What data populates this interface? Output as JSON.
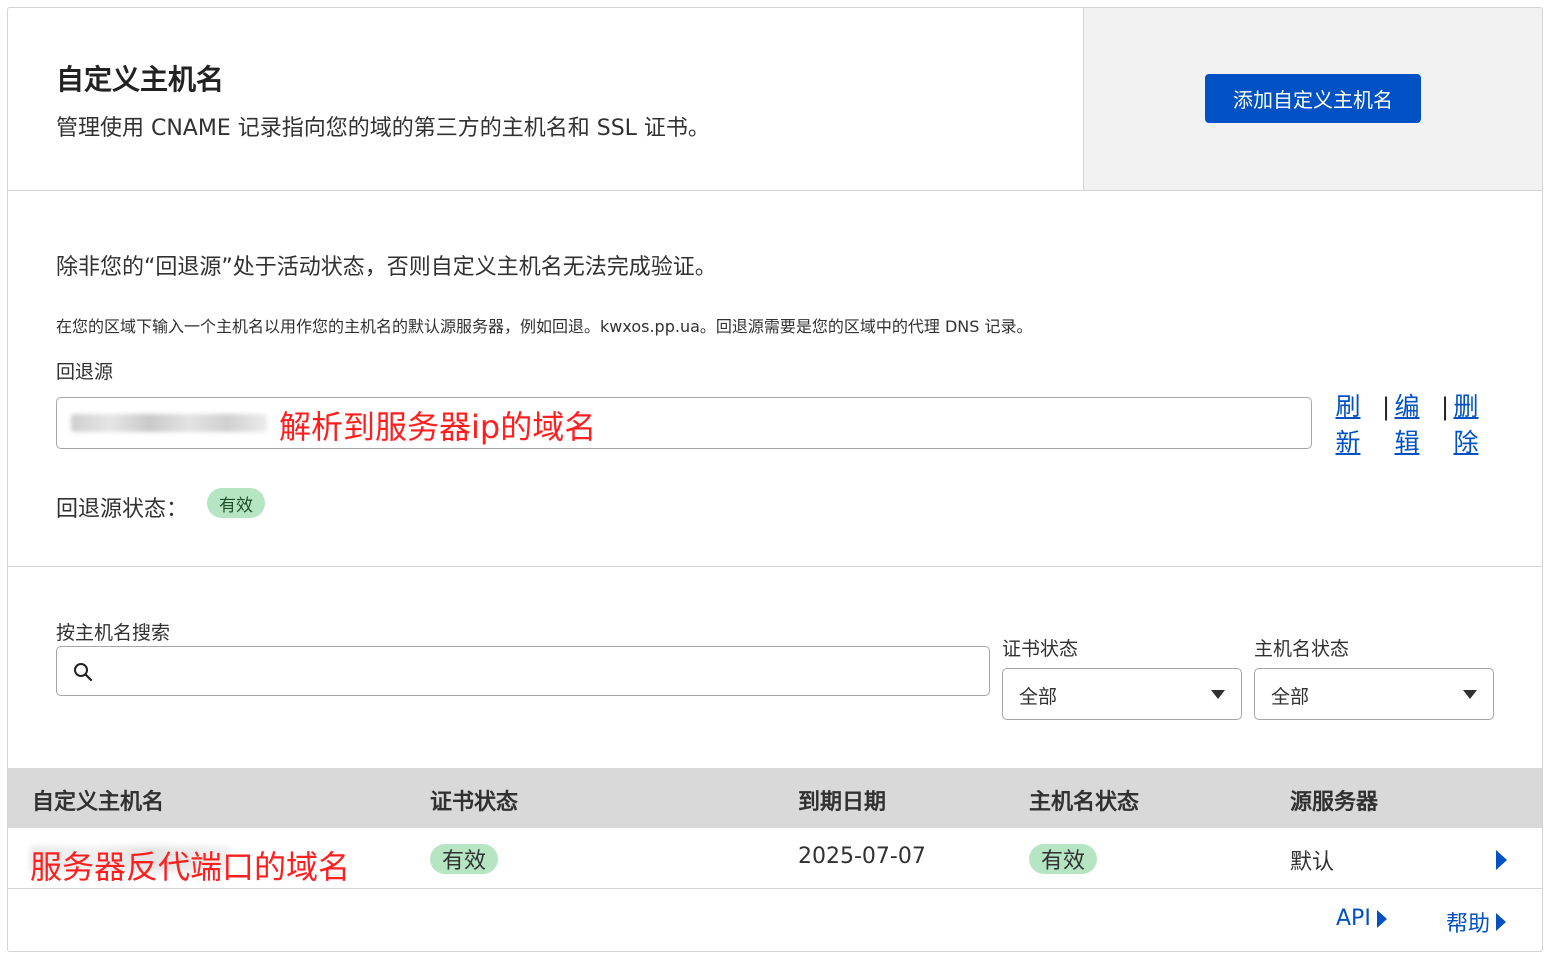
{
  "header": {
    "title": "自定义主机名",
    "subtitle": "管理使用 CNAME 记录指向您的域的第三方的主机名和 SSL 证书。",
    "add_button": "添加自定义主机名"
  },
  "fallback": {
    "notice": "除非您的“回退源”处于活动状态，否则自定义主机名无法完成验证。",
    "description": "在您的区域下输入一个主机名以用作您的主机名的默认源服务器，例如回退。kwxos.pp.ua。回退源需要是您的区域中的代理 DNS 记录。",
    "label": "回退源",
    "annotation": "解析到服务器ip的域名",
    "actions": {
      "refresh": [
        "刷",
        "新"
      ],
      "edit": [
        "编",
        "辑"
      ],
      "delete": [
        "删",
        "除"
      ],
      "separator": "|"
    },
    "status_label": "回退源状态：",
    "status_badge": "有效"
  },
  "filters": {
    "search_label": "按主机名搜索",
    "search_icon": "search-icon",
    "cert_status_label": "证书状态",
    "cert_status_value": "全部",
    "host_status_label": "主机名状态",
    "host_status_value": "全部"
  },
  "table": {
    "columns": [
      "自定义主机名",
      "证书状态",
      "到期日期",
      "主机名状态",
      "源服务器"
    ],
    "rows": [
      {
        "hostname_annotation": "服务器反代端口的域名",
        "cert_status": "有效",
        "expiry": "2025-07-07",
        "host_status": "有效",
        "origin": "默认"
      }
    ]
  },
  "footer": {
    "api_link": "API",
    "help_link": "帮助"
  },
  "colors": {
    "accent": "#0051c3",
    "badge_bg": "#b6e5c4",
    "annotation": "#ff1f1f",
    "table_header_bg": "#d9d9d9"
  }
}
